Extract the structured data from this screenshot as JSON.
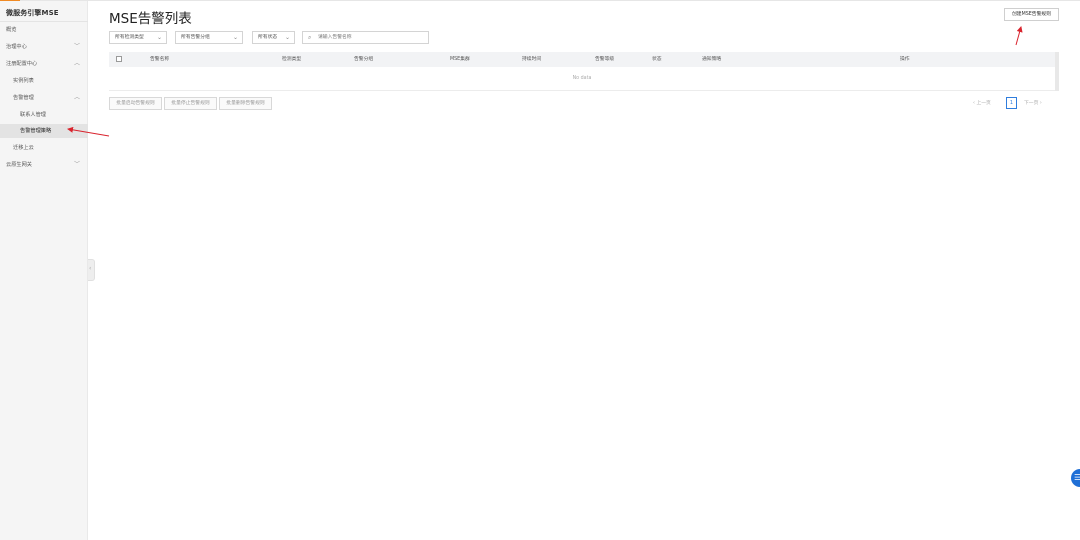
{
  "sidebar": {
    "brand": "微服务引擎MSE",
    "items": [
      {
        "label": "概览"
      },
      {
        "label": "治理中心",
        "chevron": "﹀"
      },
      {
        "label": "注册配置中心",
        "chevron": "︿"
      },
      {
        "label": "实例列表"
      },
      {
        "label": "告警管理",
        "chevron": "︿"
      },
      {
        "label": "联系人管理"
      },
      {
        "label": "告警管理策略"
      },
      {
        "label": "迁移上云"
      },
      {
        "label": "云原生网关",
        "chevron": "﹀"
      }
    ]
  },
  "main": {
    "title": "MSE告警列表",
    "create_button": "创建MSE告警规则",
    "filters": [
      {
        "label": "所有检测类型"
      },
      {
        "label": "所有告警分组"
      },
      {
        "label": "所有状态"
      }
    ],
    "search": {
      "placeholder": "请输入告警名称",
      "value": ""
    },
    "table": {
      "columns": [
        "告警名称",
        "检测类型",
        "告警分组",
        "MSE集群",
        "持续时间",
        "告警等级",
        "状态",
        "通知策略",
        "操作"
      ],
      "empty_text": "No data"
    },
    "bulk_actions": [
      "批量启动告警规则",
      "批量停止告警规则",
      "批量删除告警规则"
    ],
    "pagination": {
      "prev": "上一页",
      "next": "下一页",
      "current_page": "1"
    }
  },
  "icons": {
    "search": "search-icon",
    "dropdown": "chevron-down-icon",
    "help": "help-icon"
  },
  "colors": {
    "accent": "#f08a24",
    "primary": "#2f7ddd",
    "annotation_arrow": "#d9232d"
  }
}
